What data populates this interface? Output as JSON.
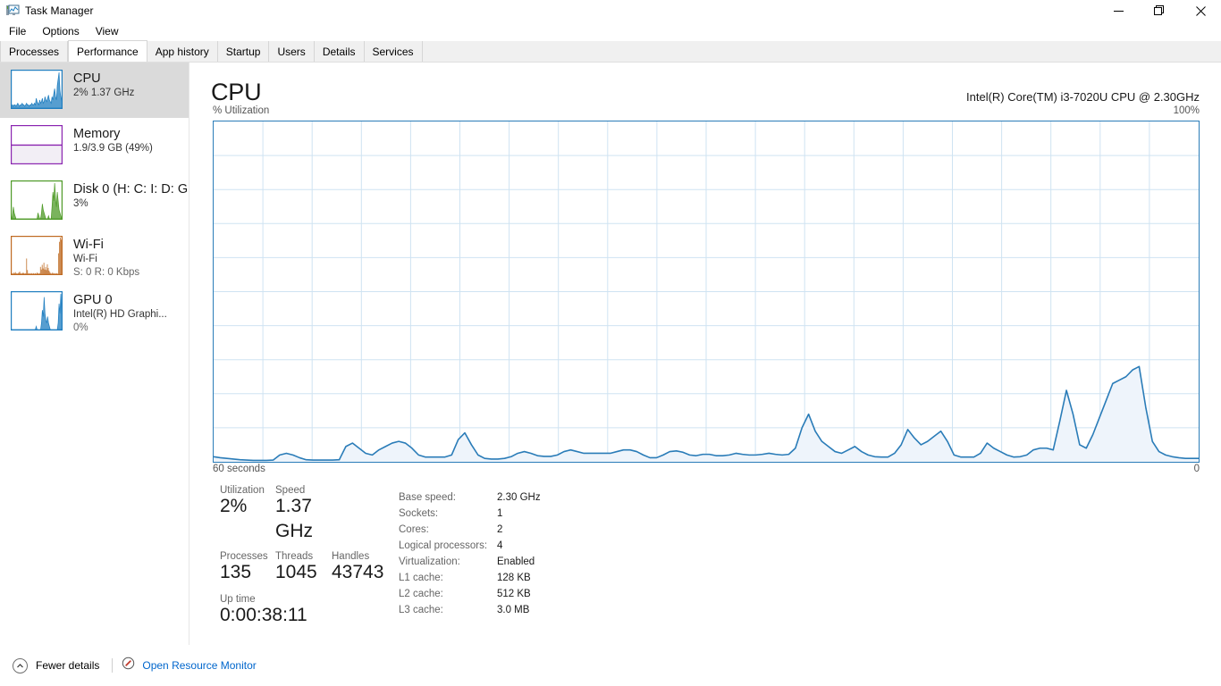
{
  "window": {
    "title": "Task Manager",
    "icon": "task-manager-icon",
    "controls": {
      "minimize": "—",
      "maximize": "❐",
      "close": "✕"
    }
  },
  "menu": {
    "items": [
      "File",
      "Options",
      "View"
    ]
  },
  "tabs": {
    "items": [
      "Processes",
      "Performance",
      "App history",
      "Startup",
      "Users",
      "Details",
      "Services"
    ],
    "active": "Performance"
  },
  "sidebar": {
    "items": [
      {
        "name": "CPU",
        "line1": "2%  1.37 GHz",
        "line2": "",
        "color": "#1f7ec0",
        "selected": true,
        "thumb": "sparkline",
        "spark": [
          2,
          1,
          2,
          1,
          2,
          2,
          1,
          2,
          3,
          2,
          1,
          2,
          2,
          3,
          2,
          2,
          1,
          2,
          3,
          2,
          2,
          1,
          2,
          2,
          3,
          2,
          2,
          3,
          2,
          6,
          4,
          3,
          2,
          5,
          3,
          4,
          6,
          3,
          4,
          7,
          5,
          4,
          6,
          8,
          5,
          4,
          3,
          7,
          5,
          9,
          12,
          7,
          5,
          14,
          18,
          22,
          11,
          7,
          5,
          3
        ]
      },
      {
        "name": "Memory",
        "line1": "1.9/3.9 GB (49%)",
        "line2": "",
        "color": "#8a24b0",
        "selected": false,
        "thumb": "fillbox",
        "fill_percent": 49
      },
      {
        "name": "Disk 0 (H: C: I: D: G",
        "line1": "3%",
        "line2": "",
        "color": "#4e9a27",
        "selected": false,
        "thumb": "sparkline",
        "spark": [
          0,
          0,
          1,
          4,
          2,
          1,
          0,
          0,
          0,
          0,
          0,
          0,
          0,
          0,
          0,
          0,
          0,
          0,
          0,
          0,
          0,
          0,
          0,
          0,
          0,
          0,
          0,
          0,
          0,
          0,
          0,
          2,
          1,
          0,
          0,
          2,
          5,
          3,
          2,
          1,
          0,
          0,
          0,
          1,
          0,
          0,
          0,
          4,
          9,
          6,
          12,
          7,
          4,
          9,
          6,
          3,
          2,
          1,
          0,
          0
        ]
      },
      {
        "name": "Wi-Fi",
        "line1": "Wi-Fi",
        "line2": "S: 0 R: 0 Kbps",
        "color": "#bf6a22",
        "selected": false,
        "thumb": "bars",
        "spark": [
          1,
          2,
          1,
          3,
          2,
          4,
          2,
          1,
          2,
          3,
          5,
          2,
          1,
          2,
          3,
          2,
          1,
          2,
          30,
          8,
          2,
          1,
          2,
          1,
          2,
          1,
          2,
          1,
          2,
          1,
          3,
          2,
          1,
          2,
          14,
          9,
          18,
          11,
          22,
          9,
          14,
          8,
          19,
          12,
          7,
          4,
          2,
          1,
          3,
          2,
          1,
          2,
          1,
          2,
          1,
          40,
          62,
          70,
          66,
          58
        ]
      },
      {
        "name": "GPU 0",
        "line1": "Intel(R) HD Graphi...",
        "line2": "0%",
        "color": "#1f7ec0",
        "selected": false,
        "thumb": "sparkline",
        "spark": [
          0,
          0,
          0,
          0,
          0,
          0,
          0,
          0,
          0,
          0,
          0,
          0,
          0,
          0,
          0,
          0,
          0,
          0,
          0,
          0,
          0,
          0,
          0,
          0,
          0,
          0,
          0,
          0,
          0,
          1,
          0,
          0,
          0,
          0,
          0,
          2,
          6,
          4,
          10,
          5,
          3,
          2,
          4,
          2,
          1,
          0,
          0,
          0,
          0,
          0,
          0,
          0,
          0,
          0,
          2,
          8,
          5,
          11,
          6,
          2
        ]
      }
    ]
  },
  "main": {
    "title": "CPU",
    "subtitle": "Intel(R) Core(TM) i3-7020U CPU @ 2.30GHz",
    "axis_left_label": "% Utilization",
    "axis_right_label": "100%",
    "axis_bottom_left": "60 seconds",
    "axis_bottom_right": "0",
    "graph_line_color": "#2a7cb8",
    "graph_fill_color": "#eef4fb",
    "graph_grid_color": "#cfe3f2"
  },
  "chart_data": {
    "type": "area",
    "title": "CPU % Utilization",
    "xlabel": "60 seconds",
    "ylabel": "% Utilization",
    "ylim": [
      0,
      100
    ],
    "xlim": [
      60,
      0
    ],
    "grid": true,
    "grid_rows": 10,
    "grid_cols": 20,
    "legend": "none",
    "line_color": "#2a7cb8",
    "fill_color": "#eef4fb",
    "series": [
      {
        "name": "CPU Utilization",
        "values": [
          1.5,
          1.2,
          1.0,
          0.8,
          0.6,
          0.5,
          0.4,
          0.4,
          0.4,
          0.5,
          2.0,
          2.5,
          2.0,
          1.2,
          0.6,
          0.5,
          0.5,
          0.5,
          0.5,
          0.6,
          4.5,
          5.5,
          4.0,
          2.5,
          2.0,
          3.5,
          4.5,
          5.5,
          6.0,
          5.5,
          4.0,
          2.0,
          1.4,
          1.4,
          1.4,
          1.4,
          2.0,
          6.5,
          8.5,
          5.0,
          2.0,
          1.0,
          0.8,
          0.8,
          1.0,
          1.5,
          2.5,
          3.0,
          2.5,
          1.8,
          1.6,
          1.6,
          2.0,
          3.0,
          3.5,
          3.0,
          2.5,
          2.5,
          2.5,
          2.5,
          2.5,
          3.0,
          3.5,
          3.5,
          3.0,
          2.0,
          1.2,
          1.2,
          2.0,
          3.0,
          3.2,
          2.8,
          2.0,
          1.8,
          2.2,
          2.2,
          1.8,
          1.8,
          2.0,
          2.5,
          2.2,
          2.0,
          2.0,
          2.2,
          2.5,
          2.2,
          2.0,
          2.2,
          4.0,
          10.0,
          14.0,
          9.0,
          6.0,
          4.5,
          3.0,
          2.5,
          3.5,
          4.5,
          3.0,
          2.0,
          1.5,
          1.4,
          1.4,
          2.5,
          5.0,
          9.5,
          7.0,
          5.0,
          6.0,
          7.5,
          9.0,
          6.0,
          2.0,
          1.4,
          1.4,
          1.4,
          2.5,
          5.5,
          4.0,
          3.0,
          2.0,
          1.4,
          1.5,
          2.0,
          3.5,
          4.0,
          4.0,
          3.5,
          12.0,
          21.0,
          14.0,
          5.0,
          4.0,
          8.0,
          13.0,
          18.0,
          23.0,
          24.0,
          25.0,
          27.0,
          28.0,
          16.0,
          6.0,
          3.0,
          2.0,
          1.5,
          1.2,
          1.0,
          1.0,
          1.0
        ]
      }
    ]
  },
  "stats": {
    "left": {
      "row1": [
        {
          "label": "Utilization",
          "value": "2%"
        },
        {
          "label": "Speed",
          "value": "1.37 GHz"
        }
      ],
      "row2": [
        {
          "label": "Processes",
          "value": "135"
        },
        {
          "label": "Threads",
          "value": "1045"
        },
        {
          "label": "Handles",
          "value": "43743"
        }
      ],
      "row3": [
        {
          "label": "Up time",
          "value": "0:00:38:11"
        }
      ]
    },
    "right": [
      {
        "key": "Base speed:",
        "value": "2.30 GHz"
      },
      {
        "key": "Sockets:",
        "value": "1"
      },
      {
        "key": "Cores:",
        "value": "2"
      },
      {
        "key": "Logical processors:",
        "value": "4"
      },
      {
        "key": "Virtualization:",
        "value": "Enabled"
      },
      {
        "key": "L1 cache:",
        "value": "128 KB"
      },
      {
        "key": "L2 cache:",
        "value": "512 KB"
      },
      {
        "key": "L3 cache:",
        "value": "3.0 MB"
      }
    ]
  },
  "footer": {
    "fewer_details_label": "Fewer details",
    "resource_monitor_label": "Open Resource Monitor",
    "resource_monitor_icon": "resource-monitor-icon",
    "chevron_icon": "chevron-up-icon"
  }
}
